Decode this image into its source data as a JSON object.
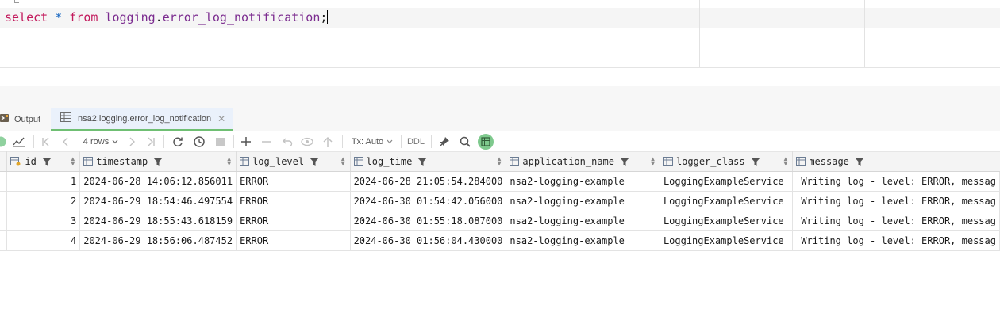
{
  "editor": {
    "query": {
      "kw_select": "select",
      "star": "*",
      "kw_from": "from",
      "schema": "logging",
      "dot": ".",
      "table": "error_log_notification",
      "semicolon": ";"
    }
  },
  "tabs": {
    "output_label": "Output",
    "result_label": "nsa2.logging.error_log_notification"
  },
  "toolbar": {
    "rows_label": "4 rows",
    "tx_label": "Tx: Auto",
    "ddl_label": "DDL"
  },
  "grid": {
    "columns": [
      "id",
      "timestamp",
      "log_level",
      "log_time",
      "application_name",
      "logger_class",
      "message"
    ],
    "rows": [
      [
        "1",
        "2024-06-28 14:06:12.856011",
        "ERROR",
        "2024-06-28 21:05:54.284000",
        "nsa2-logging-example",
        "LoggingExampleService",
        "Writing log - level: ERROR, messag"
      ],
      [
        "2",
        "2024-06-29 18:54:46.497554",
        "ERROR",
        "2024-06-30 01:54:42.056000",
        "nsa2-logging-example",
        "LoggingExampleService",
        "Writing log - level: ERROR, messag"
      ],
      [
        "3",
        "2024-06-29 18:55:43.618159",
        "ERROR",
        "2024-06-30 01:55:18.087000",
        "nsa2-logging-example",
        "LoggingExampleService",
        "Writing log - level: ERROR, messag"
      ],
      [
        "4",
        "2024-06-29 18:56:06.487452",
        "ERROR",
        "2024-06-30 01:56:04.430000",
        "nsa2-logging-example",
        "LoggingExampleService",
        "Writing log - level: ERROR, messag"
      ]
    ]
  },
  "colors": {
    "keyword": "#c2185b",
    "identifier": "#7b2b8f",
    "operator": "#1565c0",
    "active_tab_underline": "#6fbf73"
  }
}
